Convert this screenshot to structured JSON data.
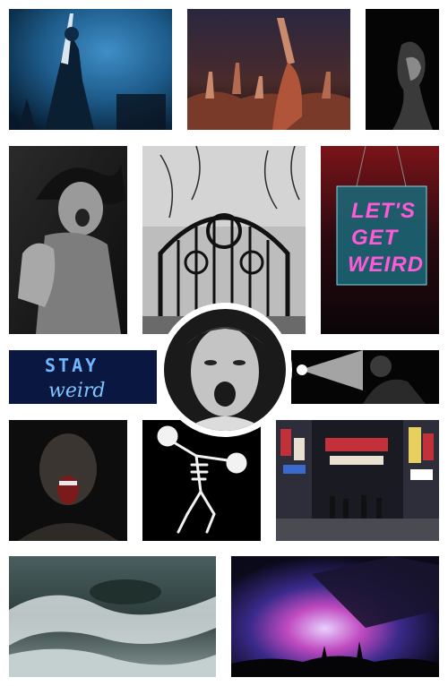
{
  "board": {
    "background": "#ffffff"
  },
  "neon_sign_1": {
    "line1": "LET'S",
    "line2": "GET",
    "line3": "WEIRD",
    "color": "#ff5ad6"
  },
  "neon_sign_2": {
    "line1": "STAY",
    "line2": "weird",
    "color": "#6fb6ff"
  },
  "palette": {
    "blue_stage": "#1d5b8a",
    "crowd_warm": "#b0553a",
    "neon_pink": "#ff5ad6",
    "neon_blue": "#6fb6ff",
    "city_red": "#c2303a",
    "concert_purple": "#6a3fb0"
  }
}
